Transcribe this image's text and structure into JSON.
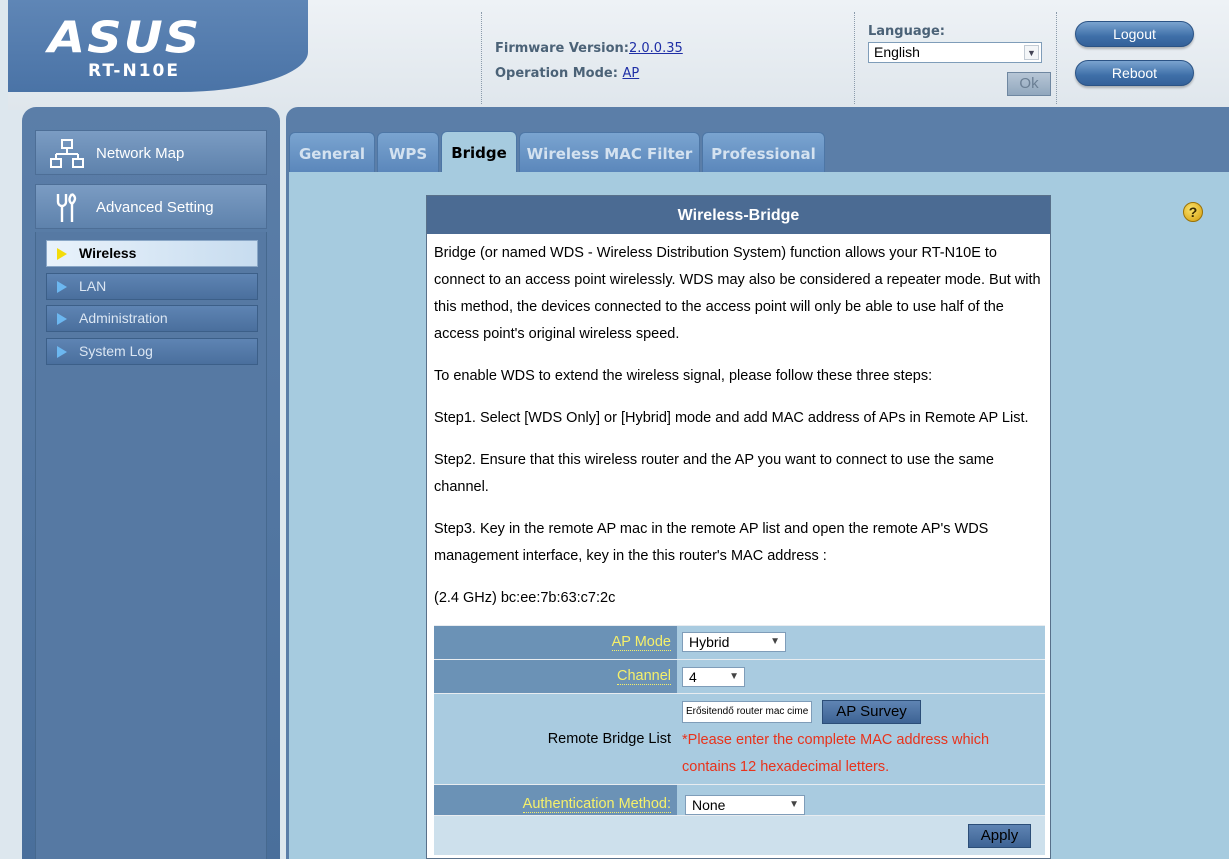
{
  "header": {
    "logo_text": "ASUS",
    "model": "RT-N10E",
    "firmware_label": "Firmware Version:",
    "firmware_value": "2.0.0.35",
    "mode_label": "Operation Mode:",
    "mode_value": "AP",
    "language_label": "Language:",
    "language_value": "English",
    "ok_label": "Ok",
    "logout_label": "Logout",
    "reboot_label": "Reboot"
  },
  "sidebar": {
    "network_map": "Network Map",
    "advanced_setting": "Advanced Setting",
    "items": [
      {
        "label": "Wireless",
        "active": true
      },
      {
        "label": "LAN",
        "active": false
      },
      {
        "label": "Administration",
        "active": false
      },
      {
        "label": "System Log",
        "active": false
      }
    ]
  },
  "tabs": [
    {
      "label": "General"
    },
    {
      "label": "WPS"
    },
    {
      "label": "Bridge",
      "active": true
    },
    {
      "label": "Wireless MAC Filter"
    },
    {
      "label": "Professional"
    }
  ],
  "panel": {
    "title": "Wireless-Bridge",
    "paragraphs": [
      "Bridge (or named WDS - Wireless Distribution System) function allows your RT-N10E to connect to an access point wirelessly. WDS may also be considered a repeater mode. But with this method, the devices connected to the access point will only be able to use half of the access point's original wireless speed.",
      "To enable WDS to extend the wireless signal, please follow these three steps:",
      "Step1. Select [WDS Only] or [Hybrid] mode and add MAC address of APs in Remote AP List.",
      "Step2. Ensure that this wireless router and the AP you want to connect to use the same channel.",
      "Step3. Key in the remote AP mac in the remote AP list and open the remote AP's WDS management interface, key in the this router's MAC address :",
      "(2.4 GHz) bc:ee:7b:63:c7:2c"
    ],
    "ap_mode_label": "AP Mode",
    "ap_mode_value": "Hybrid",
    "channel_label": "Channel",
    "channel_value": "4",
    "remote_bridge_label": "Remote Bridge List",
    "mac_input_value": "Erősitendő router mac cime",
    "ap_survey_label": "AP Survey",
    "mac_warning": "*Please enter the complete MAC address which contains 12 hexadecimal letters.",
    "auth_label": "Authentication Method:",
    "auth_value": "None",
    "apply_label": "Apply"
  },
  "colors": {
    "accent": "#4b6b93",
    "warning": "#e8331c",
    "label_yellow": "#f6f06a"
  }
}
